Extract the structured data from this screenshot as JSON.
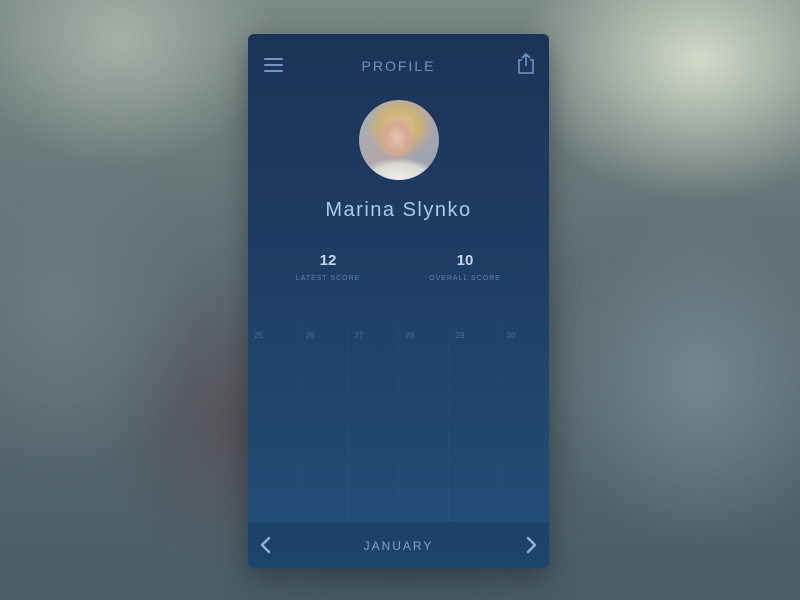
{
  "header": {
    "title": "PROFILE",
    "menu_icon": "hamburger-menu-icon",
    "share_icon": "share-icon"
  },
  "profile": {
    "name": "Marina Slynko",
    "avatar": "user-photo"
  },
  "stats": [
    {
      "value": "12",
      "label": "LATEST SCORE"
    },
    {
      "value": "10",
      "label": "OVERALL SCORE"
    }
  ],
  "chart": {
    "days": [
      "25",
      "26",
      "27",
      "28",
      "29",
      "30"
    ]
  },
  "footer": {
    "month": "JANUARY",
    "prev_icon": "chevron-left-icon",
    "next_icon": "chevron-right-icon"
  },
  "colors": {
    "card_top": "#1c3357",
    "card_bottom": "#23507a",
    "accent": "#6e92bf",
    "name_text": "#a9c9ee"
  }
}
